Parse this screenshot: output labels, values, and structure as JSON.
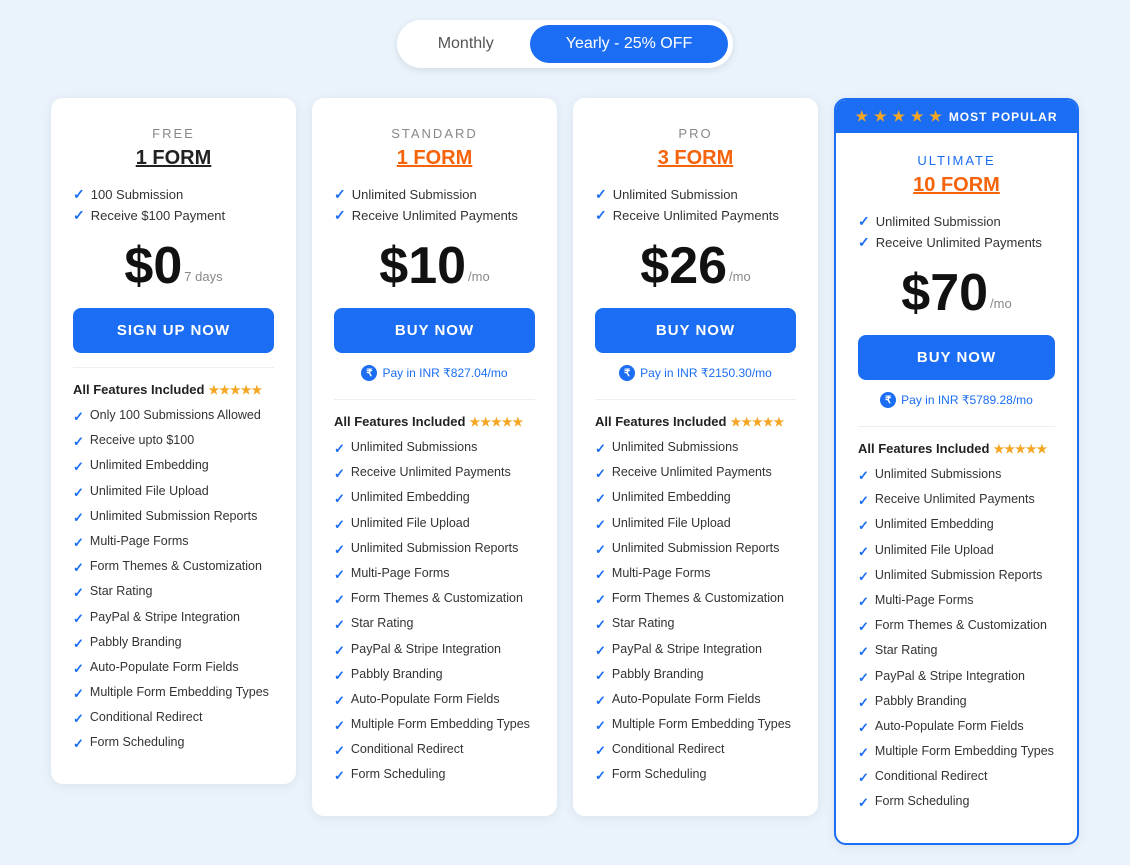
{
  "toggle": {
    "monthly_label": "Monthly",
    "yearly_label": "Yearly - 25% OFF",
    "monthly_active": false,
    "yearly_active": true
  },
  "plans": [
    {
      "id": "free",
      "tier": "FREE",
      "tier_class": "normal",
      "forms": "1 FORM",
      "forms_class": "normal",
      "popular": false,
      "highlights": [
        "100 Submission",
        "Receive $100 Payment"
      ],
      "price": "$0",
      "price_suffix": "7 days",
      "cta": "SIGN UP NOW",
      "inr": null,
      "stars": "★★★★★",
      "features": [
        "Only 100 Submissions Allowed",
        "Receive upto $100",
        "Unlimited Embedding",
        "Unlimited File Upload",
        "Unlimited Submission Reports",
        "Multi-Page Forms",
        "Form Themes & Customization",
        "Star Rating",
        "PayPal & Stripe Integration",
        "Pabbly Branding",
        "Auto-Populate Form Fields",
        "Multiple Form Embedding Types",
        "Conditional Redirect",
        "Form Scheduling"
      ]
    },
    {
      "id": "standard",
      "tier": "STANDARD",
      "tier_class": "normal",
      "forms": "1 FORM",
      "forms_class": "orange",
      "popular": false,
      "highlights": [
        "Unlimited Submission",
        "Receive Unlimited Payments"
      ],
      "price": "$10",
      "price_suffix": "/mo",
      "cta": "BUY NOW",
      "inr": "Pay in INR ₹827.04/mo",
      "stars": "★★★★★",
      "features": [
        "Unlimited Submissions",
        "Receive Unlimited Payments",
        "Unlimited Embedding",
        "Unlimited File Upload",
        "Unlimited Submission Reports",
        "Multi-Page Forms",
        "Form Themes & Customization",
        "Star Rating",
        "PayPal & Stripe Integration",
        "Pabbly Branding",
        "Auto-Populate Form Fields",
        "Multiple Form Embedding Types",
        "Conditional Redirect",
        "Form Scheduling"
      ]
    },
    {
      "id": "pro",
      "tier": "PRO",
      "tier_class": "normal",
      "forms": "3 FORM",
      "forms_class": "orange",
      "popular": false,
      "highlights": [
        "Unlimited Submission",
        "Receive Unlimited Payments"
      ],
      "price": "$26",
      "price_suffix": "/mo",
      "cta": "BUY NOW",
      "inr": "Pay in INR ₹2150.30/mo",
      "stars": "★★★★★",
      "features": [
        "Unlimited Submissions",
        "Receive Unlimited Payments",
        "Unlimited Embedding",
        "Unlimited File Upload",
        "Unlimited Submission Reports",
        "Multi-Page Forms",
        "Form Themes & Customization",
        "Star Rating",
        "PayPal & Stripe Integration",
        "Pabbly Branding",
        "Auto-Populate Form Fields",
        "Multiple Form Embedding Types",
        "Conditional Redirect",
        "Form Scheduling"
      ]
    },
    {
      "id": "ultimate",
      "tier": "ULTIMATE",
      "tier_class": "ultimate",
      "forms": "10 FORM",
      "forms_class": "orange",
      "popular": true,
      "popular_badge": "MOST POPULAR",
      "highlights": [
        "Unlimited Submission",
        "Receive Unlimited Payments"
      ],
      "price": "$70",
      "price_suffix": "/mo",
      "cta": "BUY NOW",
      "inr": "Pay in INR ₹5789.28/mo",
      "stars": "★★★★★",
      "features": [
        "Unlimited Submissions",
        "Receive Unlimited Payments",
        "Unlimited Embedding",
        "Unlimited File Upload",
        "Unlimited Submission Reports",
        "Multi-Page Forms",
        "Form Themes & Customization",
        "Star Rating",
        "PayPal & Stripe Integration",
        "Pabbly Branding",
        "Auto-Populate Form Fields",
        "Multiple Form Embedding Types",
        "Conditional Redirect",
        "Form Scheduling"
      ]
    }
  ],
  "labels": {
    "all_features": "All Features Included",
    "pay_in_inr_prefix": "Pay in INR"
  }
}
